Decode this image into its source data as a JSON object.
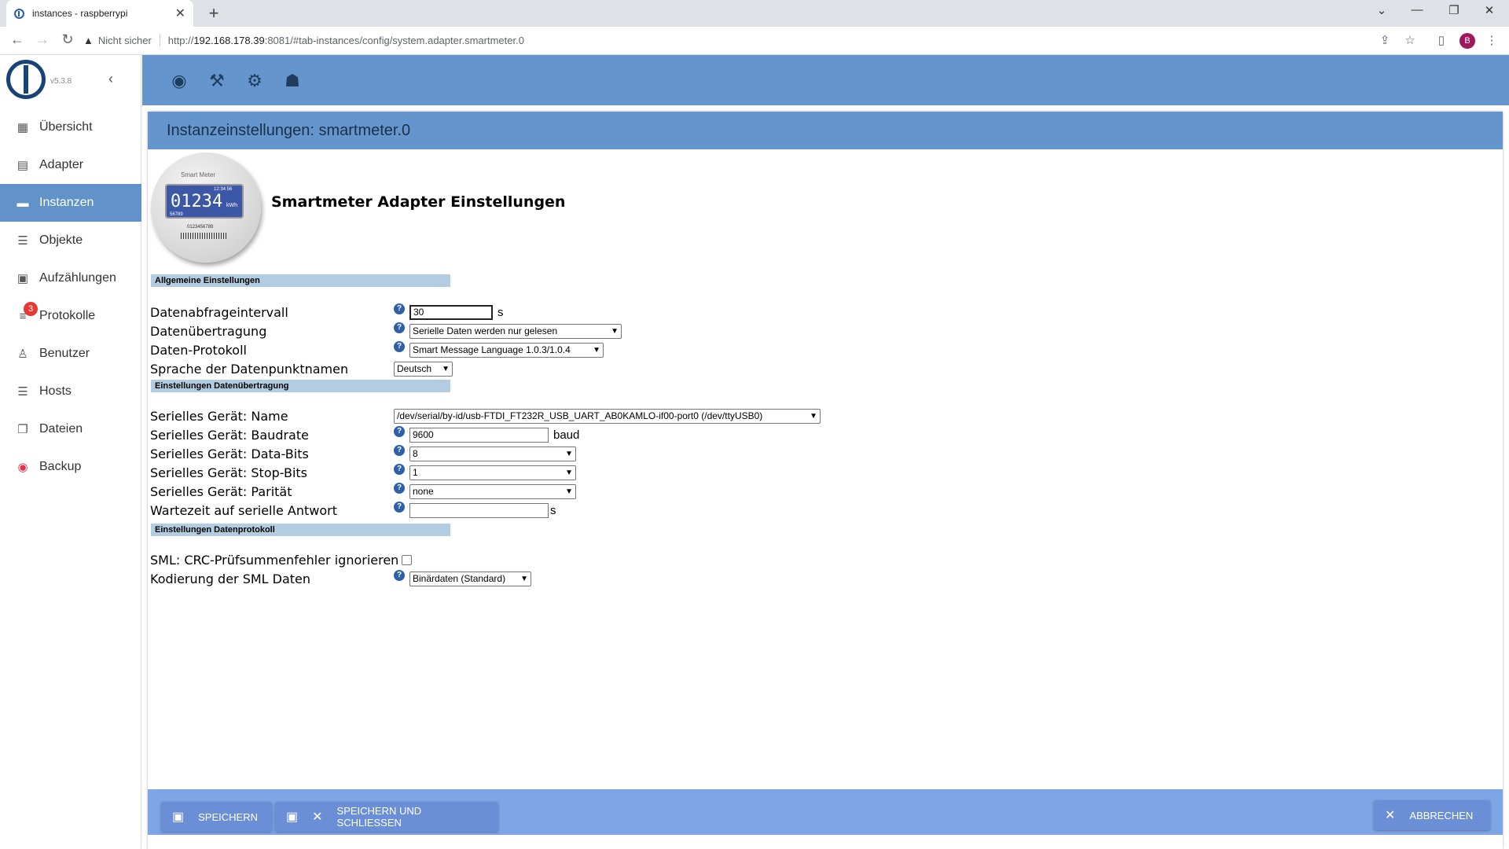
{
  "browser": {
    "tab_title": "instances - raspberrypi",
    "security_label": "Nicht sicher",
    "url_prefix": "http://",
    "url_host": "192.168.178.39",
    "url_rest": ":8081/#tab-instances/config/system.adapter.smartmeter.0",
    "profile_initial": "B"
  },
  "sidebar": {
    "version": "v5.3.8",
    "items": [
      {
        "label": "Übersicht",
        "icon": "grid-icon"
      },
      {
        "label": "Adapter",
        "icon": "store-icon"
      },
      {
        "label": "Instanzen",
        "icon": "instances-icon",
        "active": true
      },
      {
        "label": "Objekte",
        "icon": "list-icon"
      },
      {
        "label": "Aufzählungen",
        "icon": "enum-icon"
      },
      {
        "label": "Protokolle",
        "icon": "log-icon",
        "badge": "3"
      },
      {
        "label": "Benutzer",
        "icon": "user-icon"
      },
      {
        "label": "Hosts",
        "icon": "hosts-icon"
      },
      {
        "label": "Dateien",
        "icon": "files-icon"
      },
      {
        "label": "Backup",
        "icon": "backup-icon"
      }
    ]
  },
  "toolbar": {
    "icons": [
      "eye-icon",
      "wrench-icon",
      "gear-icon",
      "expert-icon"
    ]
  },
  "page": {
    "header": "Instanzeinstellungen: smartmeter.0",
    "adapter_title": "Smartmeter Adapter Einstellungen",
    "meter_image": {
      "brand": "Smart Meter",
      "reading": "01234",
      "unit": "kWh",
      "time": "12:34:56",
      "sub": "56789",
      "serial": "0123456789"
    }
  },
  "sections": {
    "general": "Allgemeine Einstellungen",
    "transfer": "Einstellungen Datenübertragung",
    "protocol": "Einstellungen Datenprotokoll"
  },
  "fields": {
    "interval": {
      "label": "Datenabfrageintervall",
      "value": "30",
      "unit": "s"
    },
    "transfer": {
      "label": "Datenübertragung",
      "value": "Serielle Daten werden nur gelesen"
    },
    "protocol": {
      "label": "Daten-Protokoll",
      "value": "Smart Message Language 1.0.3/1.0.4"
    },
    "language": {
      "label": "Sprache der Datenpunktnamen",
      "value": "Deutsch"
    },
    "device": {
      "label": "Serielles Gerät: Name",
      "value": "/dev/serial/by-id/usb-FTDI_FT232R_USB_UART_AB0KAMLO-if00-port0 (/dev/ttyUSB0)"
    },
    "baudrate": {
      "label": "Serielles Gerät: Baudrate",
      "value": "9600",
      "unit": "baud"
    },
    "databits": {
      "label": "Serielles Gerät: Data-Bits",
      "value": "8"
    },
    "stopbits": {
      "label": "Serielles Gerät: Stop-Bits",
      "value": "1"
    },
    "parity": {
      "label": "Serielles Gerät: Parität",
      "value": "none"
    },
    "timeout": {
      "label": "Wartezeit auf serielle Antwort",
      "value": "",
      "unit": "s"
    },
    "crc": {
      "label": "SML: CRC-Prüfsummenfehler ignorieren",
      "checked": false
    },
    "encoding": {
      "label": "Kodierung der SML Daten",
      "value": "Binärdaten (Standard)"
    }
  },
  "footer": {
    "save": "SPEICHERN",
    "save_close": "SPEICHERN UND SCHLIESSEN",
    "cancel": "ABBRECHEN"
  }
}
